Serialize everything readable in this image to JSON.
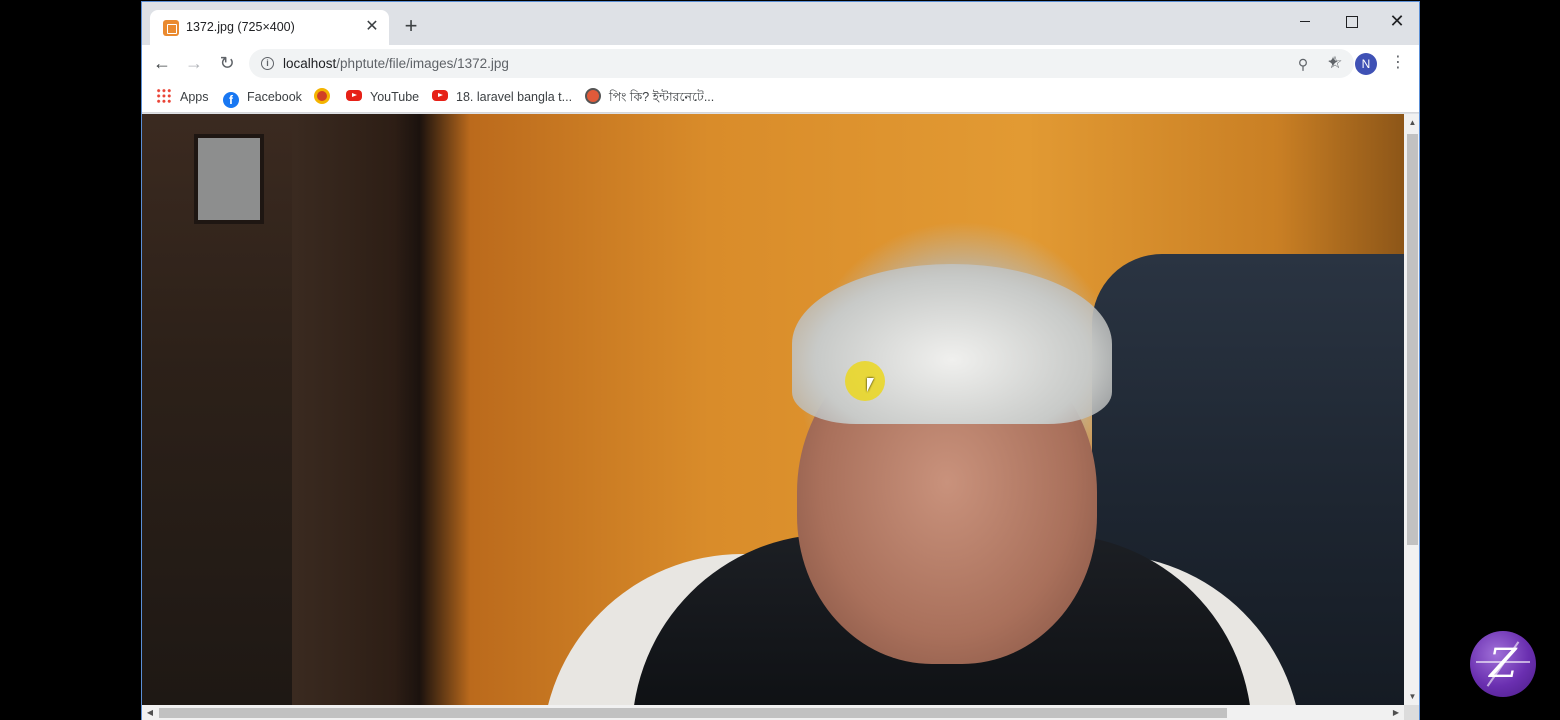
{
  "tab": {
    "title": "1372.jpg (725×400)",
    "close": "✕"
  },
  "new_tab": "+",
  "window": {
    "minimize": "",
    "maximize": "",
    "close": "✕"
  },
  "toolbar": {
    "back": "←",
    "forward": "→",
    "reload": "↻",
    "url_host": "localhost",
    "url_path": "/phptute/file/images/1372.jpg",
    "zoom_icon": "⚲",
    "star_icon": "☆",
    "extensions_icon": "✦",
    "avatar_letter": "N",
    "menu_icon": "⋮"
  },
  "bookmarks": [
    {
      "label": "Apps",
      "icon": "apps-grid-icon"
    },
    {
      "label": "Facebook",
      "icon": "facebook-icon"
    },
    {
      "label": "",
      "icon": "bangladesh-gov-icon"
    },
    {
      "label": "YouTube",
      "icon": "youtube-icon"
    },
    {
      "label": "18. laravel bangla t...",
      "icon": "youtube-icon"
    },
    {
      "label": "পিং কি? ইন্টারনেটে...",
      "icon": "site-icon"
    }
  ],
  "icons": {
    "facebook_letter": "f"
  },
  "scroll": {
    "up": "▲",
    "down": "▼",
    "left": "◀",
    "right": "▶"
  },
  "logo_letter": "Z",
  "colors": {
    "avatar": "#3f51b5",
    "cursor_highlight": "#ebd71e",
    "window_border": "#5b8fd6"
  }
}
